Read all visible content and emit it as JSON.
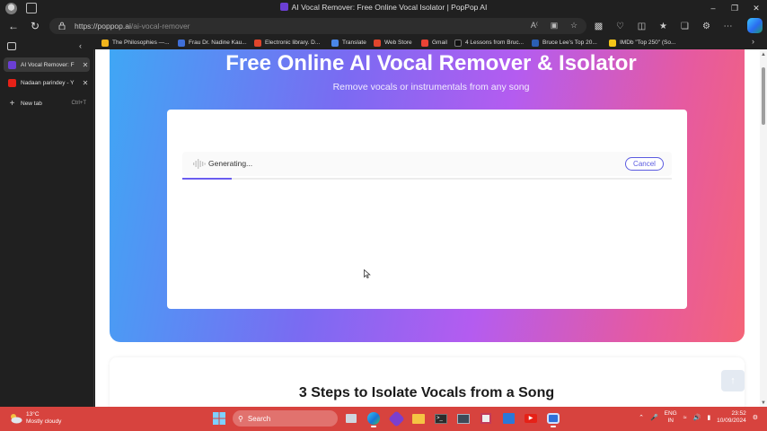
{
  "window": {
    "title": "AI Vocal Remover: Free Online Vocal Isolator | PopPop AI"
  },
  "address_bar": {
    "url_host": "https://poppop.ai",
    "url_path": "/ai-vocal-remover"
  },
  "bookmarks": [
    {
      "label": "The Philosophies —...",
      "icon": "philosophy-icon",
      "color": "#f2b51c"
    },
    {
      "label": "Frau Dr. Nadine Kau...",
      "icon": "doc-icon",
      "color": "#3f6fd8"
    },
    {
      "label": "Electronic library. D...",
      "icon": "library-icon",
      "color": "#e0452c"
    },
    {
      "label": "Translate",
      "icon": "translate-icon",
      "color": "#4a86e8"
    },
    {
      "label": "Web Store",
      "icon": "webstore-icon",
      "color": "#e0452c"
    },
    {
      "label": "Gmail",
      "icon": "gmail-icon",
      "color": "#ea4335"
    },
    {
      "label": "4 Lessons from Bruc...",
      "icon": "medium-icon",
      "color": "#111111"
    },
    {
      "label": "Bruce Lee's Top 20...",
      "icon": "wikipedia-icon",
      "color": "#2b5fb5"
    },
    {
      "label": "IMDb \"Top 250\" (So...",
      "icon": "imdb-icon",
      "color": "#f5c518"
    }
  ],
  "tabs": [
    {
      "label": "AI Vocal Remover: F",
      "active": true,
      "color": "#6b3fd4"
    },
    {
      "label": "Nadaan parindey - Y",
      "active": false,
      "color": "#e62117"
    }
  ],
  "new_tab": {
    "label": "New tab",
    "shortcut": "Ctrl+T"
  },
  "page": {
    "hero_title": "Free Online AI Vocal Remover & Isolator",
    "hero_subtitle": "Remove vocals or instrumentals from any song",
    "status_text": "Generating...",
    "cancel_label": "Cancel",
    "progress": 0.1,
    "steps_title": "3 Steps to Isolate Vocals from a Song"
  },
  "taskbar": {
    "weather_temp": "13°C",
    "weather_desc": "Mostly cloudy",
    "search_placeholder": "Search",
    "lang_line1": "ENG",
    "lang_line2": "IN",
    "time": "23:52",
    "date": "10/09/2024"
  },
  "colors": {
    "hero_gradient_start": "#3fa7f5",
    "hero_gradient_end": "#f46478",
    "accent": "#5b5be0",
    "taskbar": "#d7433e"
  }
}
